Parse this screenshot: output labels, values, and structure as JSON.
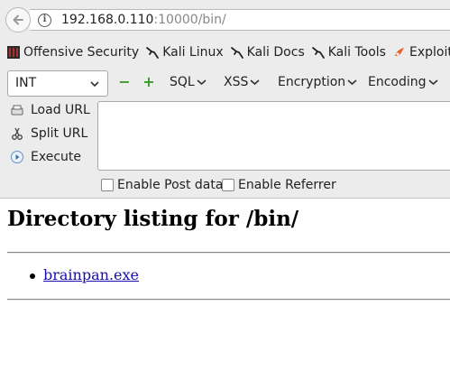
{
  "urlbar": {
    "host": "192.168.0.110",
    "rest": ":10000/bin/"
  },
  "bookmarks": [
    {
      "label": "Offensive Security",
      "icon": "offsec-icon"
    },
    {
      "label": "Kali Linux",
      "icon": "kali-dragon-icon"
    },
    {
      "label": "Kali Docs",
      "icon": "kali-dragon-icon"
    },
    {
      "label": "Kali Tools",
      "icon": "kali-dragon-icon"
    },
    {
      "label": "Exploit-DB",
      "icon": "exploitdb-icon"
    }
  ],
  "hackbar": {
    "select_value": "INT",
    "minus": "−",
    "plus": "+",
    "menus": [
      "SQL",
      "XSS",
      "Encryption",
      "Encoding"
    ],
    "load_url": "Load URL",
    "split_url": "Split URL",
    "execute": "Execute",
    "enable_post": "Enable Post data",
    "enable_referrer": "Enable Referrer"
  },
  "page": {
    "heading": "Directory listing for /bin/",
    "files": [
      "brainpan.exe"
    ]
  },
  "colors": {
    "chrome_bg": "#ececec",
    "link": "#1a0dab",
    "plus_minus": "#3a9a2a"
  }
}
